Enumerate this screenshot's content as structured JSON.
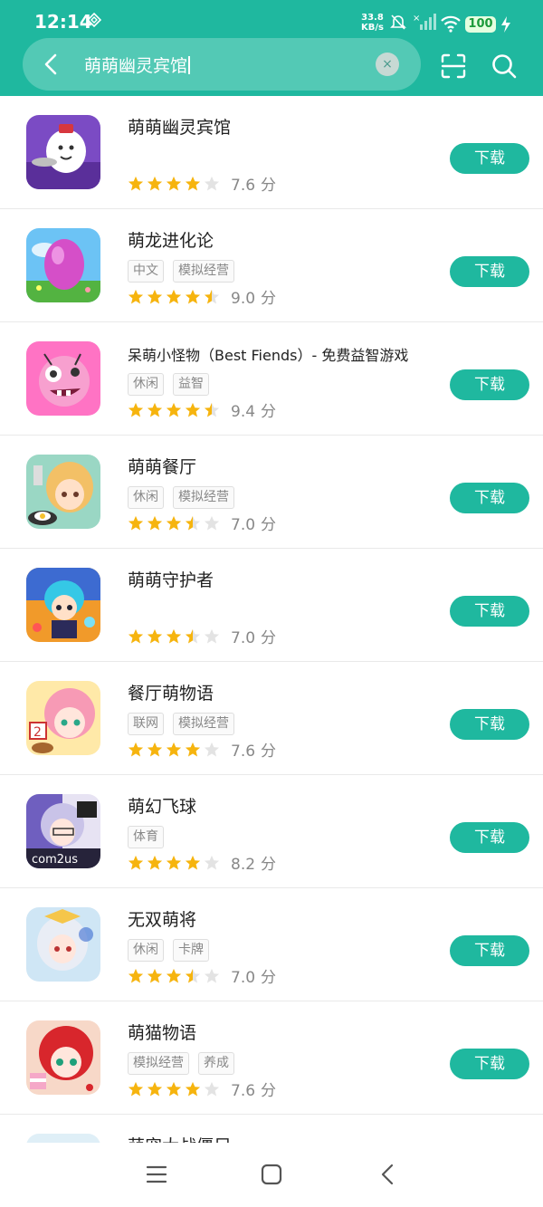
{
  "status_bar": {
    "time": "12:14",
    "net_speed_value": "33.8",
    "net_speed_unit": "KB/s",
    "battery": "100"
  },
  "search": {
    "query": "萌萌幽灵宾馆",
    "clear_glyph": "×"
  },
  "icons": {
    "back": "back-arrow-icon",
    "scan": "scan-icon",
    "search": "search-icon",
    "nav_menu": "menu-icon",
    "nav_home": "home-icon",
    "nav_back": "back-icon"
  },
  "colors": {
    "accent": "#1fb89f",
    "star_filled": "#f6b40e",
    "star_empty": "#e3e3e3"
  },
  "download_label": "下载",
  "score_unit": "分",
  "apps": [
    {
      "title": "萌萌幽灵宾馆",
      "tags": [],
      "rating": 4,
      "score": "7.6"
    },
    {
      "title": "萌龙进化论",
      "tags": [
        "中文",
        "模拟经营"
      ],
      "rating": 4.5,
      "score": "9.0"
    },
    {
      "title": "呆萌小怪物（Best Fiends）- 免费益智游戏",
      "tags": [
        "休闲",
        "益智"
      ],
      "rating": 4.5,
      "score": "9.4"
    },
    {
      "title": "萌萌餐厅",
      "tags": [
        "休闲",
        "模拟经营"
      ],
      "rating": 3.5,
      "score": "7.0"
    },
    {
      "title": "萌萌守护者",
      "tags": [],
      "rating": 3.5,
      "score": "7.0"
    },
    {
      "title": "餐厅萌物语",
      "tags": [
        "联网",
        "模拟经营"
      ],
      "rating": 4,
      "score": "7.6"
    },
    {
      "title": "萌幻飞球",
      "tags": [
        "体育"
      ],
      "rating": 4,
      "score": "8.2"
    },
    {
      "title": "无双萌将",
      "tags": [
        "休闲",
        "卡牌"
      ],
      "rating": 3.5,
      "score": "7.0"
    },
    {
      "title": "萌猫物语",
      "tags": [
        "模拟经营",
        "养成"
      ],
      "rating": 4,
      "score": "7.6"
    },
    {
      "title": "萌宠大战僵尸",
      "tags": [],
      "rating": 0,
      "score": ""
    }
  ],
  "icon_label_com2us": "com2us"
}
